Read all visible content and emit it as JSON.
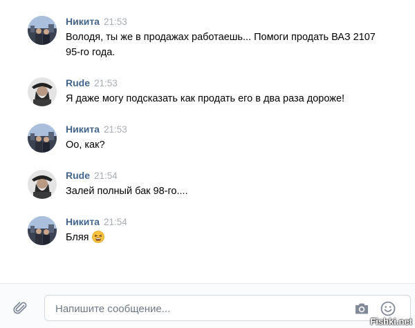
{
  "messages": [
    {
      "author": "Никита",
      "time": "21:53",
      "text": "Володя, ты же в продажах работаешь... Помоги продать ВАЗ 2107 95-го года.",
      "avatar_icon": "user-avatar-nikita"
    },
    {
      "author": "Rude",
      "time": "21:53",
      "text": "Я даже могу подсказать как продать его в два раза дороже!",
      "avatar_icon": "user-avatar-rude"
    },
    {
      "author": "Никита",
      "time": "21:53",
      "text": "Оо, как?",
      "avatar_icon": "user-avatar-nikita"
    },
    {
      "author": "Rude",
      "time": "21:54",
      "text": "Залей полный бак 98-го....",
      "avatar_icon": "user-avatar-rude"
    },
    {
      "author": "Никита",
      "time": "21:54",
      "text": "Бляя",
      "emoji": "tired-face-emoji",
      "avatar_icon": "user-avatar-nikita"
    }
  ],
  "composer": {
    "placeholder": "Напишите сообщение...",
    "attach_icon": "paperclip-icon",
    "camera_icon": "camera-icon",
    "emoji_icon": "smile-icon"
  },
  "watermark": "Fishki.net",
  "colors": {
    "author": "#42648b",
    "time": "#a8adb3",
    "composer_bg": "#fafbfc",
    "border": "#d3d9de",
    "icon": "#828a99"
  }
}
